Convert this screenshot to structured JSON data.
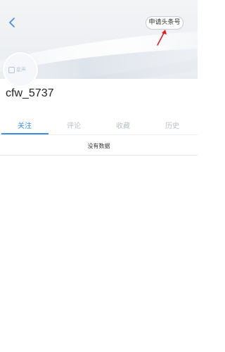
{
  "header": {
    "back_icon": "chevron-left-icon",
    "apply_label": "申请头条号",
    "annotation_color": "#e02020"
  },
  "profile": {
    "avatar_logo_text": "星声",
    "username": "cfw_5737"
  },
  "tabs": [
    {
      "label": "关注",
      "active": true
    },
    {
      "label": "评论",
      "active": false
    },
    {
      "label": "收藏",
      "active": false
    },
    {
      "label": "历史",
      "active": false
    }
  ],
  "content": {
    "empty_text": "没有数据"
  },
  "colors": {
    "accent": "#3b8de8",
    "inactive_tab": "#b9bec6"
  }
}
